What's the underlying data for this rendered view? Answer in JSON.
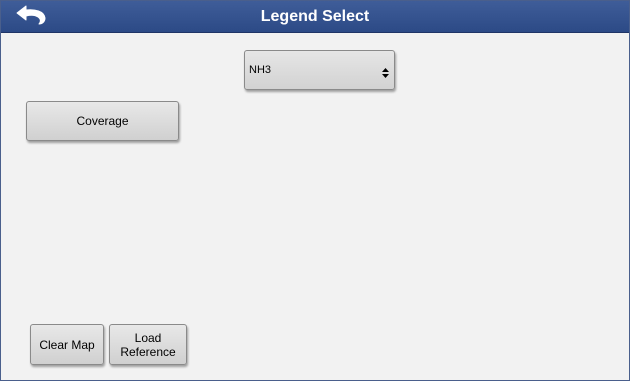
{
  "window": {
    "title": "Legend Select",
    "back_icon": "back-arrow-icon"
  },
  "legend_select": {
    "selected": "NH3"
  },
  "buttons": {
    "coverage": "Coverage",
    "clear_map": "Clear Map",
    "load_reference": "Load Reference"
  },
  "colors": {
    "titlebar": "#35528f",
    "content_bg": "#f2f2f2",
    "button": "#dcdcdc"
  }
}
